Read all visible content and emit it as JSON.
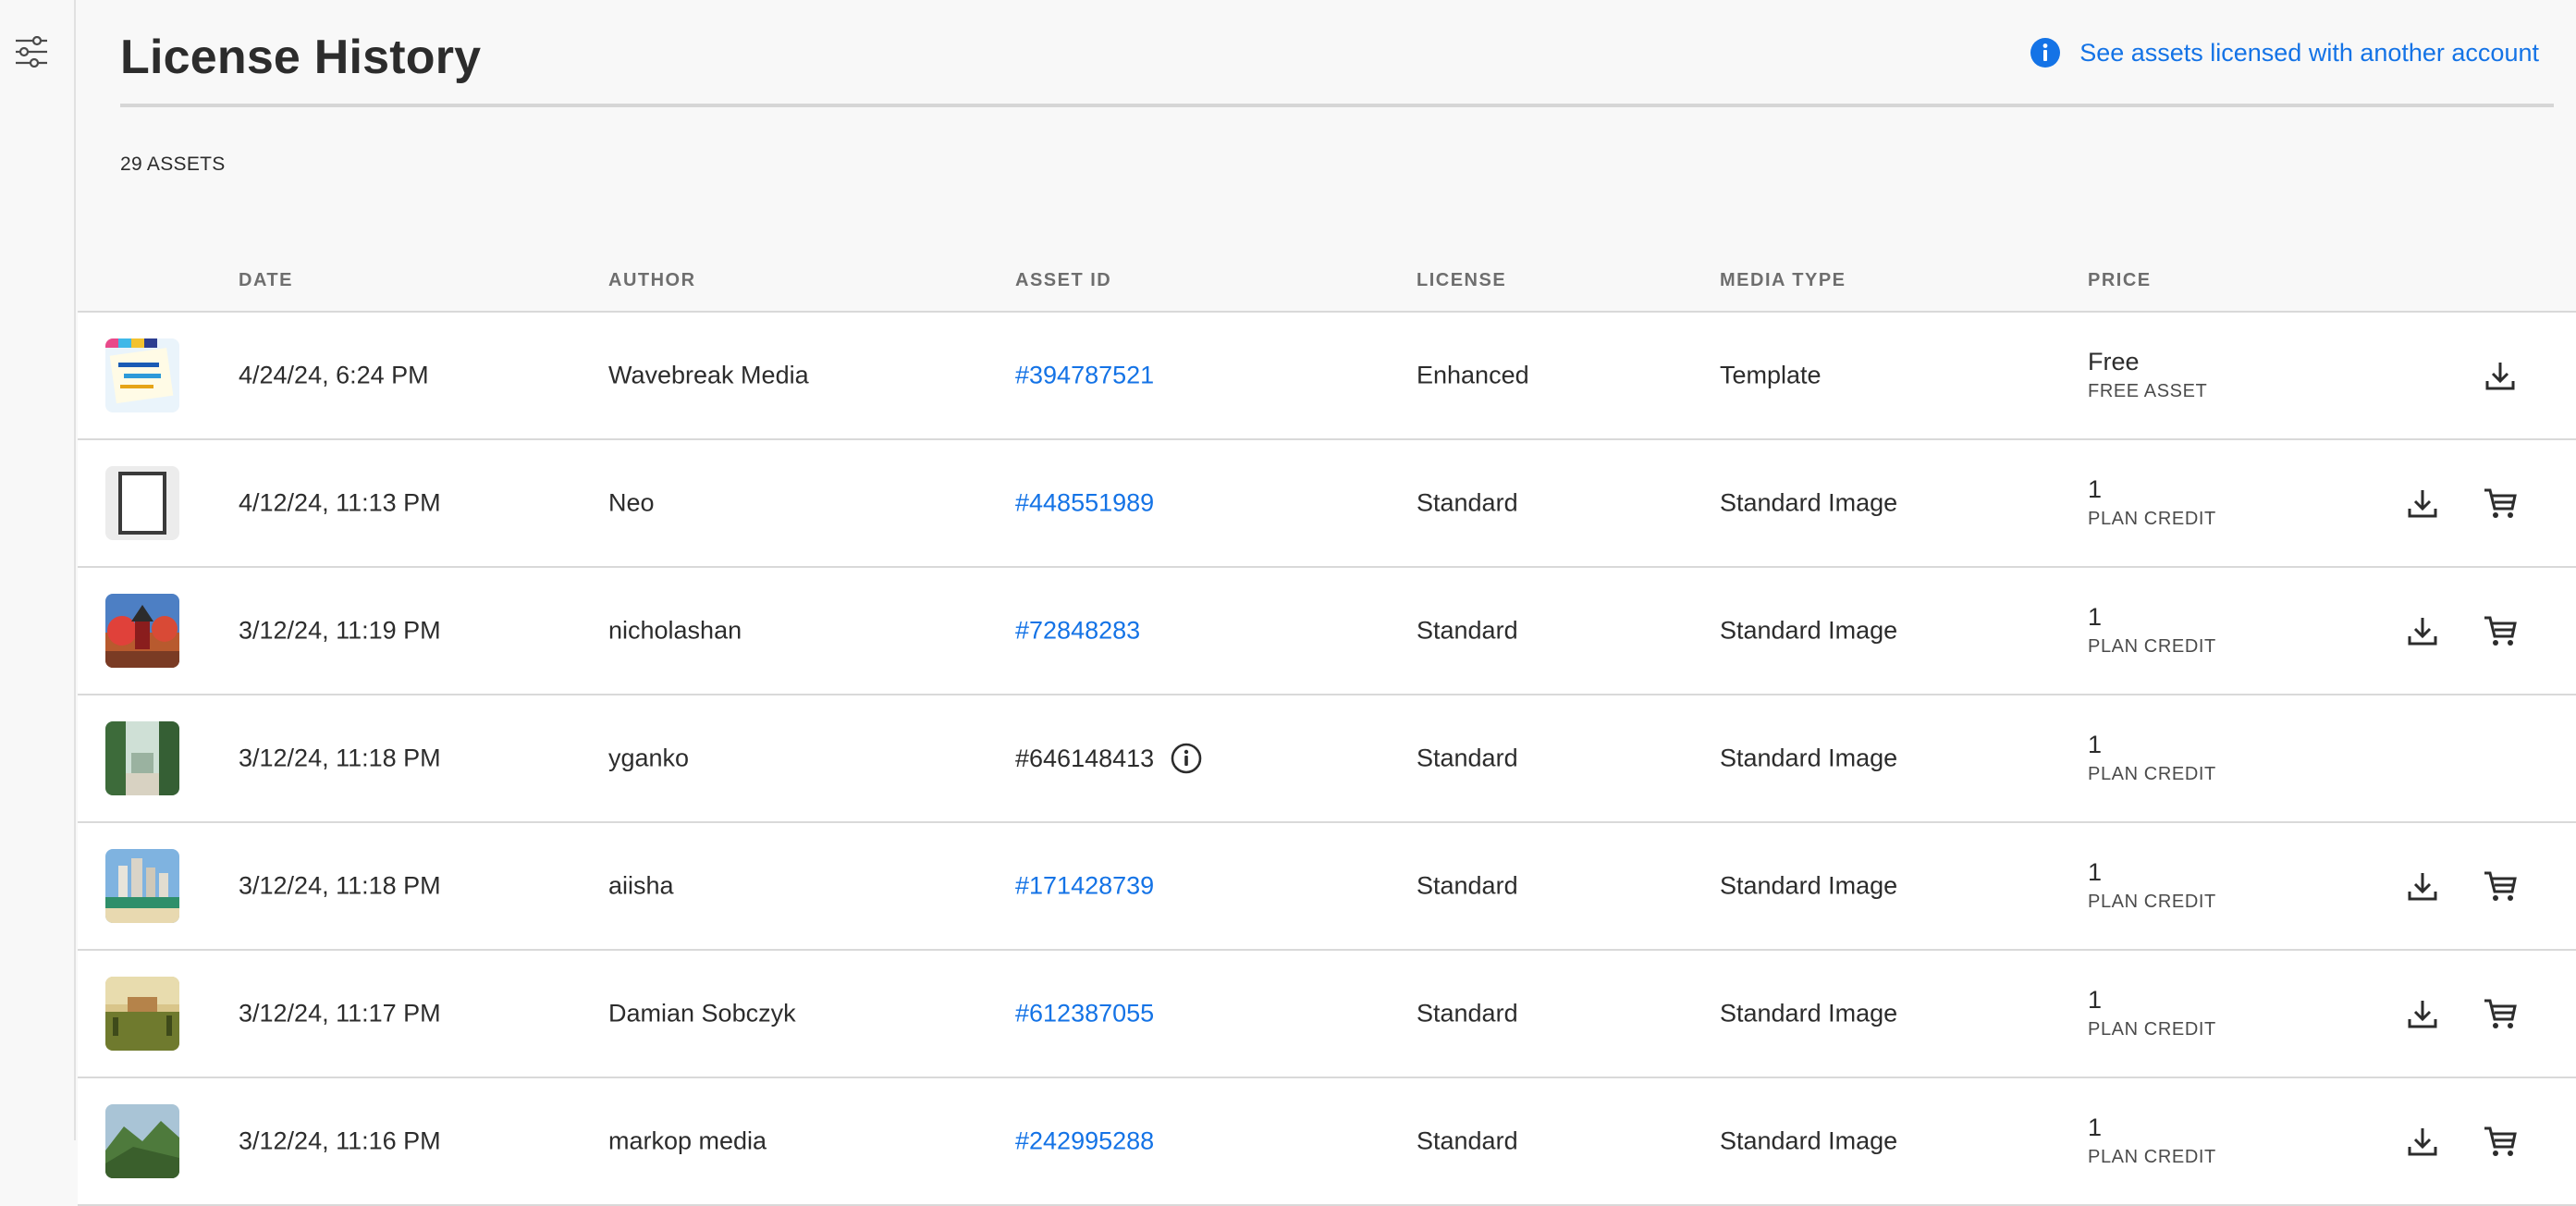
{
  "header": {
    "title": "License History",
    "other_account_link": "See assets licensed with another account"
  },
  "summary": {
    "asset_count": "29 ASSETS"
  },
  "table": {
    "columns": [
      "DATE",
      "AUTHOR",
      "ASSET ID",
      "LICENSE",
      "MEDIA TYPE",
      "PRICE"
    ],
    "rows": [
      {
        "date": "4/24/24, 6:24 PM",
        "author": "Wavebreak Media",
        "asset_id": "#394787521",
        "license": "Enhanced",
        "media_type": "Template",
        "price": "Free",
        "price_unit": "FREE ASSET"
      },
      {
        "date": "4/12/24, 11:13 PM",
        "author": "Neo",
        "asset_id": "#448551989",
        "license": "Standard",
        "media_type": "Standard Image",
        "price": "1",
        "price_unit": "PLAN CREDIT"
      },
      {
        "date": "3/12/24, 11:19 PM",
        "author": "nicholashan",
        "asset_id": "#72848283",
        "license": "Standard",
        "media_type": "Standard Image",
        "price": "1",
        "price_unit": "PLAN CREDIT"
      },
      {
        "date": "3/12/24, 11:18 PM",
        "author": "yganko",
        "asset_id": "#646148413",
        "license": "Standard",
        "media_type": "Standard Image",
        "price": "1",
        "price_unit": "PLAN CREDIT"
      },
      {
        "date": "3/12/24, 11:18 PM",
        "author": "aiisha",
        "asset_id": "#171428739",
        "license": "Standard",
        "media_type": "Standard Image",
        "price": "1",
        "price_unit": "PLAN CREDIT"
      },
      {
        "date": "3/12/24, 11:17 PM",
        "author": "Damian Sobczyk",
        "asset_id": "#612387055",
        "license": "Standard",
        "media_type": "Standard Image",
        "price": "1",
        "price_unit": "PLAN CREDIT"
      },
      {
        "date": "3/12/24, 11:16 PM",
        "author": "markop media",
        "asset_id": "#242995288",
        "license": "Standard",
        "media_type": "Standard Image",
        "price": "1",
        "price_unit": "PLAN CREDIT"
      }
    ]
  },
  "colors": {
    "link": "#1473e6",
    "text": "#2c2c2c",
    "background": "#f8f8f8"
  },
  "icons": [
    "filter-icon",
    "info-icon",
    "download-icon",
    "cart-icon"
  ]
}
